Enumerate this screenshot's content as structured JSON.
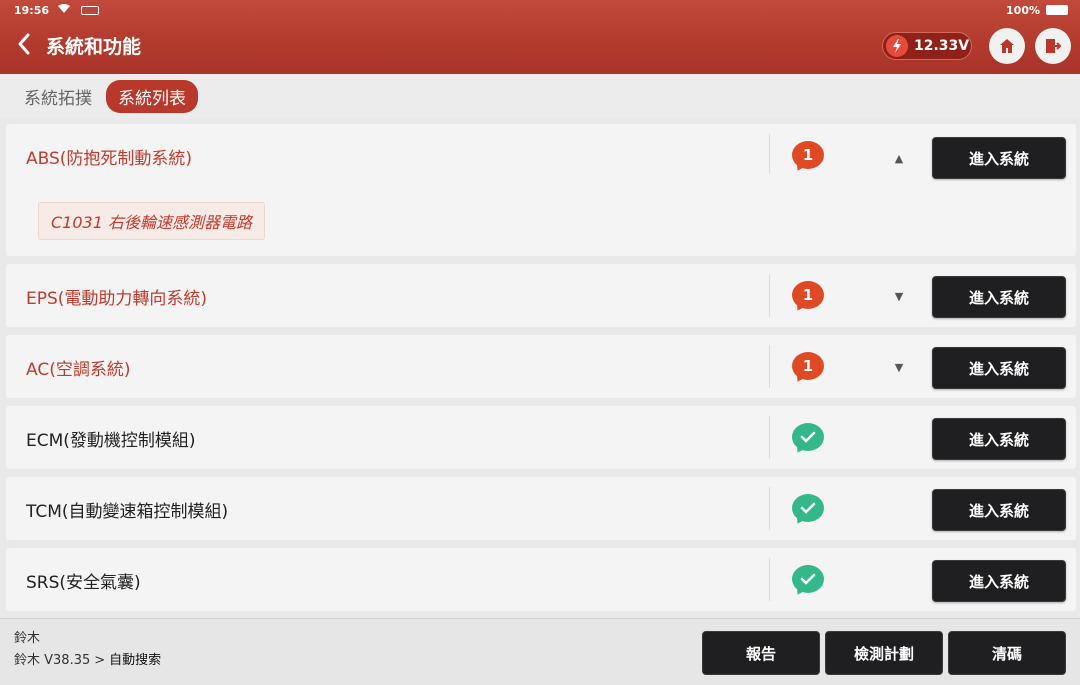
{
  "status_bar": {
    "time": "19:56",
    "battery": "100%"
  },
  "header": {
    "title": "系統和功能",
    "voltage": "12.33V",
    "accent_color": "#b23a2d"
  },
  "tabs": [
    {
      "label": "系統拓撲",
      "active": false
    },
    {
      "label": "系統列表",
      "active": true
    }
  ],
  "systems": [
    {
      "name": "ABS(防抱死制動系統)",
      "status": "fault",
      "fault_count": "1",
      "expanded": true,
      "dtc": "C1031 右後輪速感測器電路",
      "button": "進入系統"
    },
    {
      "name": "EPS(電動助力轉向系統)",
      "status": "fault",
      "fault_count": "1",
      "expanded": false,
      "button": "進入系統"
    },
    {
      "name": "AC(空調系統)",
      "status": "fault",
      "fault_count": "1",
      "expanded": false,
      "button": "進入系統"
    },
    {
      "name": "ECM(發動機控制模組)",
      "status": "ok",
      "button": "進入系統"
    },
    {
      "name": "TCM(自動變速箱控制模組)",
      "status": "ok",
      "button": "進入系統"
    },
    {
      "name": "SRS(安全氣囊)",
      "status": "ok",
      "button": "進入系統"
    }
  ],
  "footer": {
    "vehicle": "鈴木",
    "path_make": "鈴木 V38.35",
    "path_separator": ">",
    "path_current": "自動搜索",
    "buttons": {
      "report": "報告",
      "test_plan": "檢測計劃",
      "clear_codes": "清碼"
    }
  }
}
